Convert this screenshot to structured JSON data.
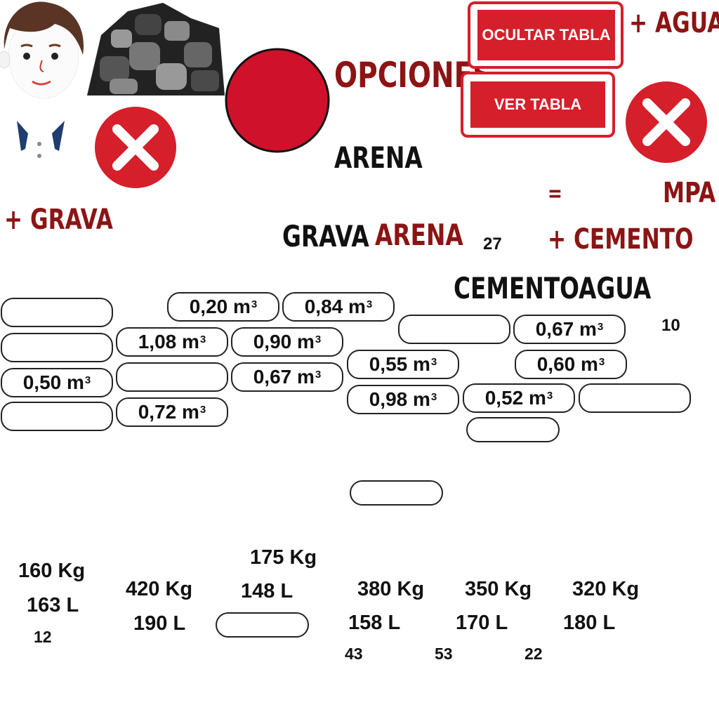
{
  "header": {
    "opciones": "OPCIONES",
    "arena_top": "ARENA",
    "mas_agua": "+ AGUA",
    "igual": "=",
    "mpa": "MPA",
    "mas_grava": "+ GRAVA",
    "grava": "GRAVA",
    "arena": "ARENA",
    "numero_27": "27",
    "mas_cemento": "+ CEMENTO",
    "cemento": "CEMENTO",
    "agua": "AGUA",
    "numero_10": "10"
  },
  "buttons": {
    "ocultar_tabla": "OCULTAR TABLA",
    "ver_tabla": "VER TABLA"
  },
  "unit_superscript": "3",
  "volumes": {
    "v020": "0,20 m",
    "v084": "0,84 m",
    "v108": "1,08 m",
    "v090": "0,90 m",
    "v067a": "0,67 m",
    "v067b": "0,67 m",
    "v050": "0,50 m",
    "v055": "0,55 m",
    "v060": "0,60 m",
    "v098": "0,98 m",
    "v052": "0,52 m",
    "v072": "0,72 m"
  },
  "bottom": {
    "kg160": "160 Kg",
    "l163": "163 L",
    "n12": "12",
    "kg420": "420 Kg",
    "l190": "190 L",
    "kg175": "175 Kg",
    "l148": "148 L",
    "kg380": "380 Kg",
    "l158": "158 L",
    "n43": "43",
    "kg350": "350 Kg",
    "l170": "170 L",
    "n53": "53",
    "kg320": "320 Kg",
    "l180": "180 L",
    "n22": "22"
  },
  "colors": {
    "red": "#d51f2a",
    "dark_red": "#8c1414"
  }
}
